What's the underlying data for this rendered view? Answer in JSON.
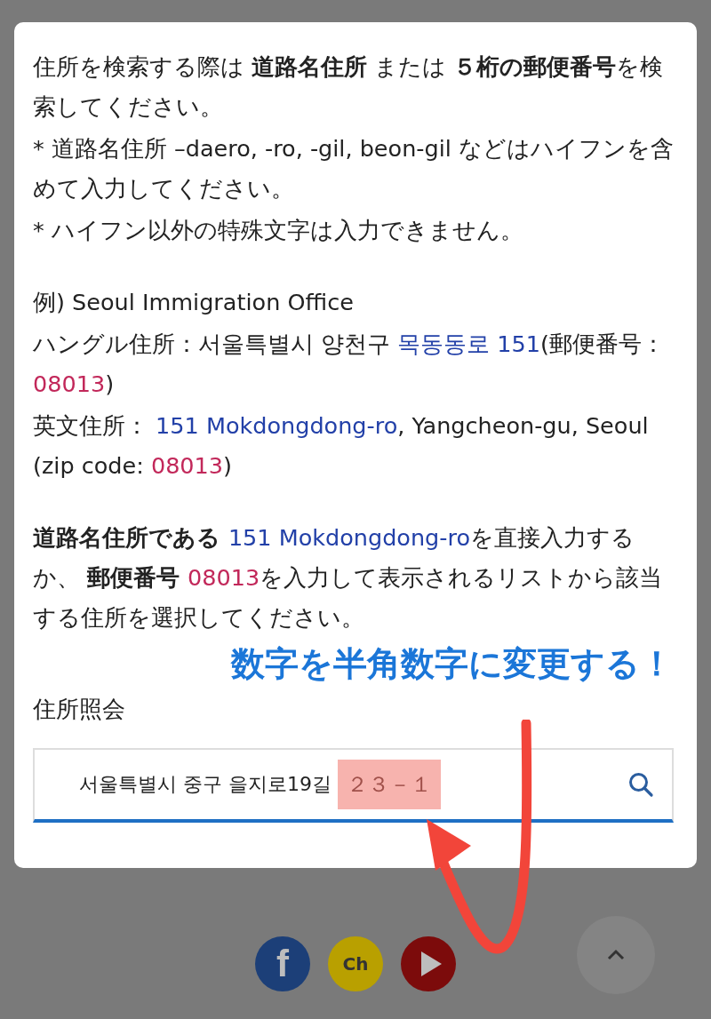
{
  "dialog": {
    "paragraphs": [
      {
        "kind": "note",
        "segments": [
          {
            "kind": "plain",
            "text": "住所を検索する際は "
          },
          {
            "kind": "bold",
            "text": "道路名住所"
          },
          {
            "kind": "plain",
            "text": " または "
          },
          {
            "kind": "bold",
            "text": "５桁の郵便番号"
          },
          {
            "kind": "plain",
            "text": "を検索してください。"
          }
        ]
      },
      {
        "kind": "note",
        "segments": [
          {
            "kind": "plain",
            "text": "* 道路名住所 –daero, -ro, -gil, beon-gil などはハイフンを含めて入力してください。"
          }
        ]
      },
      {
        "kind": "note",
        "segments": [
          {
            "kind": "plain",
            "text": "* ハイフン以外の特殊文字は入力できません。"
          }
        ]
      },
      {
        "kind": "gap",
        "segments": [
          {
            "kind": "plain",
            "text": "例) Seoul Immigration Office"
          }
        ]
      },
      {
        "kind": "note",
        "segments": [
          {
            "kind": "plain",
            "text": "ハングル住所：서울특별시 양천구 "
          },
          {
            "kind": "road",
            "text": "목동동로 151"
          },
          {
            "kind": "plain",
            "text": "(郵便番号："
          },
          {
            "kind": "zip",
            "text": "08013"
          },
          {
            "kind": "plain",
            "text": ")"
          }
        ]
      },
      {
        "kind": "note",
        "segments": [
          {
            "kind": "plain",
            "text": "英文住所： "
          },
          {
            "kind": "road",
            "text": "151 Mokdongdong-ro"
          },
          {
            "kind": "plain",
            "text": ", Yangcheon-gu, Seoul (zip code: "
          },
          {
            "kind": "zip",
            "text": "08013"
          },
          {
            "kind": "plain",
            "text": ")"
          }
        ]
      },
      {
        "kind": "gap",
        "segments": [
          {
            "kind": "bold",
            "text": "道路名住所である "
          },
          {
            "kind": "road",
            "text": "151 Mokdongdong-ro"
          },
          {
            "kind": "plain",
            "text": "を直接入力するか、 "
          },
          {
            "kind": "bold",
            "text": "郵便番号 "
          },
          {
            "kind": "zip",
            "text": "08013"
          },
          {
            "kind": "plain",
            "text": "を入力して表示されるリストから該当する住所を選択してください。"
          }
        ]
      }
    ],
    "annotation": "数字を半角数字に変更する！",
    "search_label": "住所照会",
    "search_field": {
      "value": "서울특별시 중구 을지로19길 ",
      "highlighted_value": "２３－１"
    }
  },
  "footer": {
    "social": [
      {
        "kind": "facebook",
        "label": "f"
      },
      {
        "kind": "kakao",
        "label": "Ch"
      },
      {
        "kind": "youtube"
      }
    ]
  }
}
